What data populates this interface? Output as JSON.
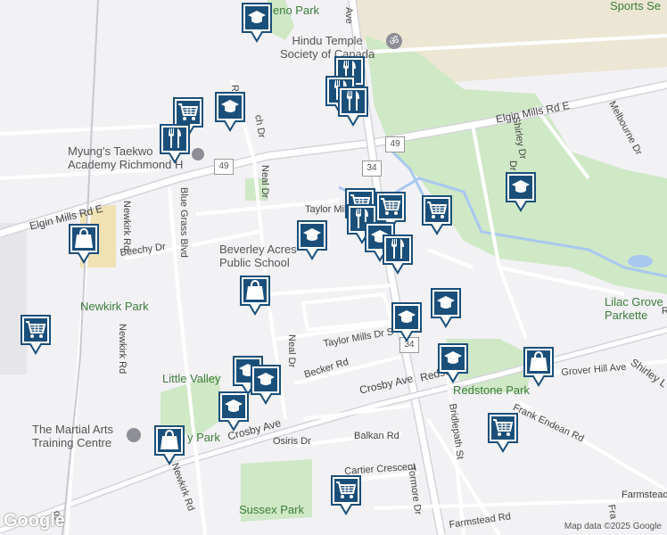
{
  "colors": {
    "background": "#f2f1f4",
    "park": "#c8e6c0",
    "road": "#ffffff",
    "highway": "#d9d9de",
    "pin": "#1a4f7a",
    "water": "#a8c8f0"
  },
  "labels": {
    "park_top": "eno Park",
    "hindu_temple": "Hindu Temple\nSociety of Canada",
    "sports": "Sports Se",
    "elgin_east": "Elgin Mills Rd E",
    "elgin_west": "Elgin Mills Rd E",
    "myungs": "Myung's Taekwo\nAcademy Richmond H",
    "beverley": "Beverley Acres\nPublic School",
    "taylor_mills_top": "Taylor Mills",
    "taylor_mills_dr": "Taylor Mills Dr S",
    "newkirk_park": "Newkirk Park",
    "little_valley": "Little Valley",
    "martial_arts": "The Martial Arts\nTraining Centre",
    "lilac_grove": "Lilac Grove\nParkette",
    "redstone_park": "Redstone Park",
    "crosby_ave_right": "Crosby Ave",
    "crosby_ave_left": "Crosby Ave",
    "redstone": "Redsto",
    "becker": "Becker Rd",
    "osiris": "Osiris Dr",
    "balkan": "Balkan Rd",
    "cartier": "Cartier Crescent",
    "sussex_park": "Sussex Park",
    "grover_hill": "Grover Hill Ave",
    "frank_endean": "Frank Endean Rd",
    "farmstead_rd": "Farmstead Rd",
    "farmstead_right": "Farmstead",
    "beechy": "Beechy Dr",
    "newkirk_rd": "Newkirk Rd",
    "newkirk_rd_bottom": "Newkirk Rd",
    "blue_grass": "Blue Grass Blvd",
    "neal_dr": "Neal Dr",
    "neal_dr_lower": "Neal Dr",
    "shirley_dr": "Shirley Dr",
    "melbourne": "Melbourne Dr",
    "bridlepath": "Bridlepath St",
    "tormore": "Tormore Dr",
    "shirley_lower": "Shirley L",
    "route49_a": "49",
    "route49_b": "49",
    "route34_a": "34",
    "route34_b": "34",
    "y_park": "y Park",
    "ri": "ri",
    "ro": "Ro",
    "ch_dr": "ch Dr",
    "ave": "Ave",
    "dr": "Dr",
    "fr": "Fra",
    "ri2": "R",
    "bosl": "osl",
    "google": "Google",
    "attribution": "Map data ©2025 Google"
  },
  "pins": [
    {
      "type": "school",
      "icon": "graduation-cap-icon"
    },
    {
      "type": "restaurant",
      "icon": "fork-knife-icon"
    },
    {
      "type": "restaurant",
      "icon": "fork-knife-icon"
    },
    {
      "type": "restaurant",
      "icon": "fork-knife-icon"
    },
    {
      "type": "grocery",
      "icon": "shopping-cart-icon"
    },
    {
      "type": "school",
      "icon": "graduation-cap-icon"
    },
    {
      "type": "restaurant",
      "icon": "fork-knife-icon"
    },
    {
      "type": "grocery",
      "icon": "shopping-cart-icon"
    },
    {
      "type": "restaurant",
      "icon": "fork-knife-icon"
    },
    {
      "type": "grocery",
      "icon": "shopping-cart-icon"
    },
    {
      "type": "grocery",
      "icon": "shopping-cart-icon"
    },
    {
      "type": "school",
      "icon": "graduation-cap-icon"
    },
    {
      "type": "restaurant",
      "icon": "fork-knife-icon"
    },
    {
      "type": "school",
      "icon": "graduation-cap-icon"
    },
    {
      "type": "school",
      "icon": "graduation-cap-icon"
    },
    {
      "type": "shopping",
      "icon": "shopping-bag-icon"
    },
    {
      "type": "shopping",
      "icon": "shopping-bag-icon"
    },
    {
      "type": "grocery",
      "icon": "shopping-cart-icon"
    },
    {
      "type": "school",
      "icon": "graduation-cap-icon"
    },
    {
      "type": "school",
      "icon": "graduation-cap-icon"
    },
    {
      "type": "school",
      "icon": "graduation-cap-icon"
    },
    {
      "type": "school",
      "icon": "graduation-cap-icon"
    },
    {
      "type": "shopping",
      "icon": "shopping-bag-icon"
    },
    {
      "type": "school",
      "icon": "graduation-cap-icon"
    },
    {
      "type": "grocery",
      "icon": "shopping-cart-icon"
    },
    {
      "type": "shopping",
      "icon": "shopping-bag-icon"
    },
    {
      "type": "grocery",
      "icon": "shopping-cart-icon"
    },
    {
      "type": "school",
      "icon": "graduation-cap-icon"
    }
  ]
}
